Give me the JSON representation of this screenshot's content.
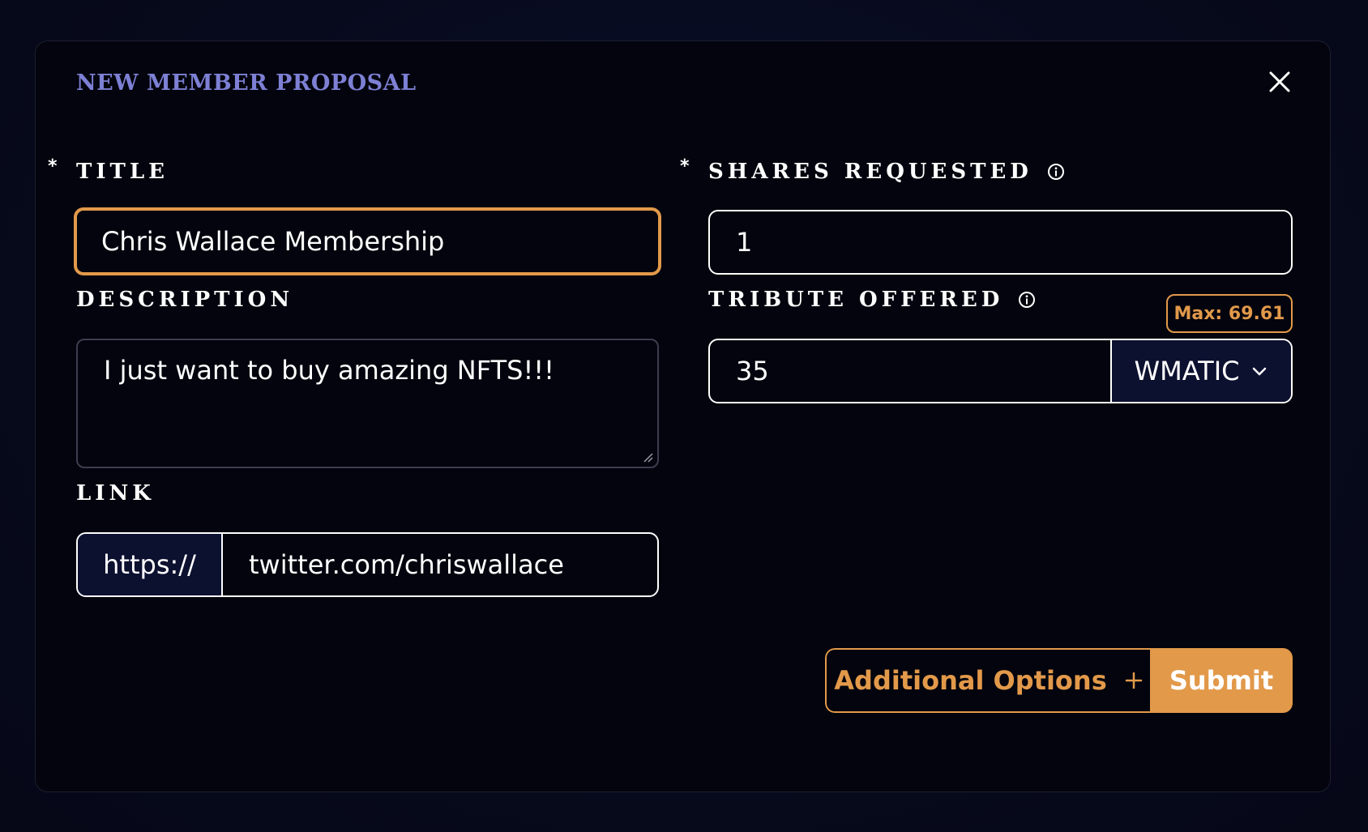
{
  "modal": {
    "title": "NEW MEMBER PROPOSAL"
  },
  "form": {
    "title_label": "TITLE",
    "title_value": "Chris Wallace Membership",
    "description_label": "DESCRIPTION",
    "description_value": "I just want to buy amazing NFTS!!!",
    "link_label": "LINK",
    "link_prefix": "https://",
    "link_value": "twitter.com/chriswallace",
    "shares_label": "SHARES REQUESTED",
    "shares_value": "1",
    "tribute_label": "TRIBUTE OFFERED",
    "tribute_value": "35",
    "tribute_max": "Max: 69.61",
    "token_selected": "WMATIC",
    "required_marker": "*"
  },
  "actions": {
    "additional_options_label": "Additional Options",
    "submit_label": "Submit"
  },
  "colors": {
    "accent": "#e2994a",
    "title": "#7d80d4",
    "background": "#03040d"
  },
  "icons": {
    "close": "close-icon",
    "info": "info-icon",
    "chevron": "chevron-down-icon",
    "plus": "plus-icon",
    "asterisk": "required-asterisk-icon"
  }
}
